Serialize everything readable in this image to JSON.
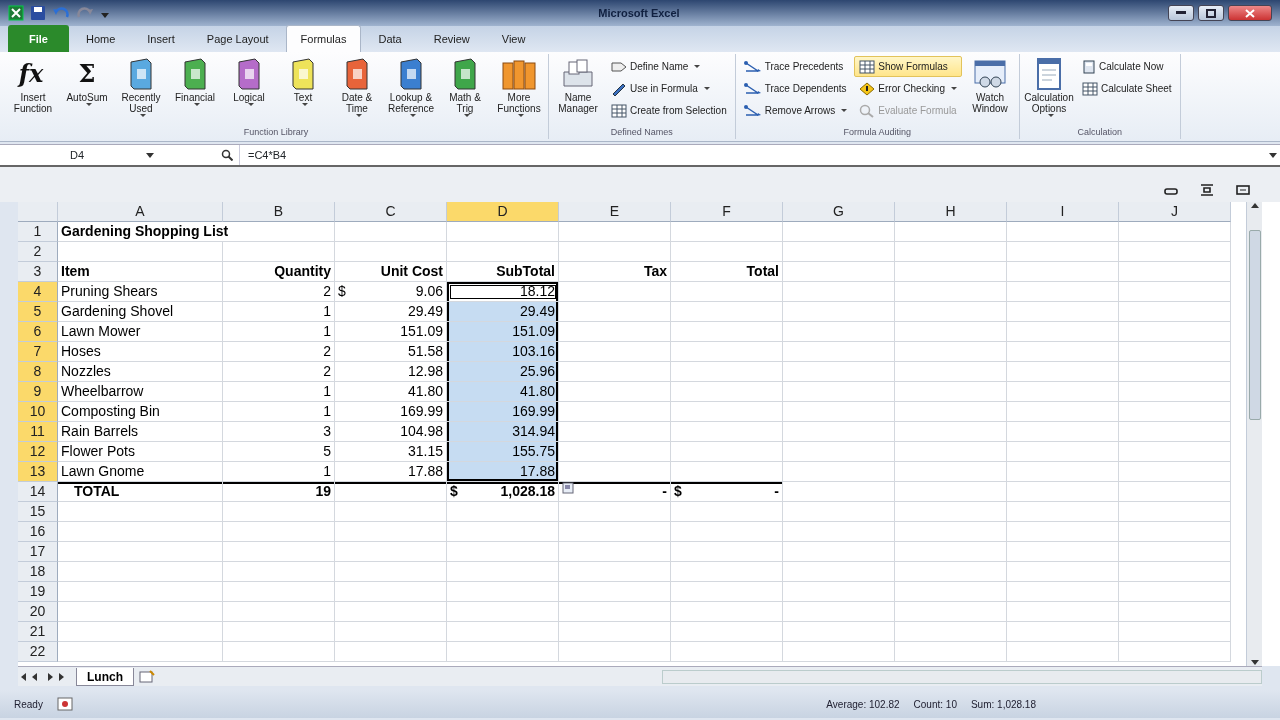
{
  "title_bar": {
    "title": "Microsoft Excel"
  },
  "tabs": [
    {
      "label": "File",
      "kind": "file",
      "selected": false
    },
    {
      "label": "Home",
      "kind": "tab",
      "selected": false
    },
    {
      "label": "Insert",
      "kind": "tab",
      "selected": false
    },
    {
      "label": "Page Layout",
      "kind": "tab",
      "selected": false
    },
    {
      "label": "Formulas",
      "kind": "tab",
      "selected": true
    },
    {
      "label": "Data",
      "kind": "tab",
      "selected": false
    },
    {
      "label": "Review",
      "kind": "tab",
      "selected": false
    },
    {
      "label": "View",
      "kind": "tab",
      "selected": false
    }
  ],
  "ribbon_groups": [
    {
      "label": "Function Library",
      "items": [
        {
          "kind": "large",
          "label": "Insert Function",
          "glyph": "fx",
          "dropdown": false
        },
        {
          "kind": "large",
          "label": "AutoSum",
          "glyph": "Σ",
          "dropdown": true
        },
        {
          "kind": "large",
          "label": "Recently Used",
          "dropdown": true
        },
        {
          "kind": "large",
          "label": "Financial",
          "dropdown": true
        },
        {
          "kind": "large",
          "label": "Logical",
          "dropdown": true
        },
        {
          "kind": "large",
          "label": "Text",
          "dropdown": true
        },
        {
          "kind": "large",
          "label": "Date & Time",
          "dropdown": true
        },
        {
          "kind": "large",
          "label": "Lookup & Reference",
          "dropdown": true
        },
        {
          "kind": "large",
          "label": "Math & Trig",
          "dropdown": true
        },
        {
          "kind": "large",
          "label": "More Functions",
          "dropdown": true
        }
      ]
    },
    {
      "label": "Defined Names",
      "items": [
        {
          "kind": "large",
          "label": "Name Manager",
          "dropdown": false
        },
        {
          "kind": "stack",
          "buttons": [
            {
              "label": "Define Name",
              "dropdown": true,
              "hovered": false,
              "disabled": false
            },
            {
              "label": "Use in Formula",
              "dropdown": true,
              "hovered": false,
              "disabled": false
            },
            {
              "label": "Create from Selection",
              "dropdown": false,
              "hovered": false,
              "disabled": false
            }
          ]
        }
      ]
    },
    {
      "label": "Formula Auditing",
      "items": [
        {
          "kind": "stack",
          "buttons": [
            {
              "label": "Trace Precedents",
              "dropdown": false,
              "hovered": false,
              "disabled": false
            },
            {
              "label": "Trace Dependents",
              "dropdown": false,
              "hovered": false,
              "disabled": false
            },
            {
              "label": "Remove Arrows",
              "dropdown": true,
              "hovered": false,
              "disabled": false
            }
          ]
        },
        {
          "kind": "stack",
          "buttons": [
            {
              "label": "Show Formulas",
              "dropdown": false,
              "hovered": true,
              "disabled": false
            },
            {
              "label": "Error Checking",
              "dropdown": true,
              "hovered": false,
              "disabled": false
            },
            {
              "label": "Evaluate Formula",
              "dropdown": false,
              "hovered": false,
              "disabled": true
            }
          ]
        },
        {
          "kind": "large",
          "label": "Watch Window",
          "dropdown": false
        }
      ]
    },
    {
      "label": "Calculation",
      "items": [
        {
          "kind": "large",
          "label": "Calculation Options",
          "dropdown": true
        },
        {
          "kind": "stack",
          "buttons": [
            {
              "label": "Calculate Now",
              "dropdown": false,
              "hovered": false,
              "disabled": false
            },
            {
              "label": "Calculate Sheet",
              "dropdown": false,
              "hovered": false,
              "disabled": false
            }
          ]
        }
      ]
    }
  ],
  "formula_bar": {
    "name_box": "D4",
    "formula": "=C4*B4"
  },
  "sheet": {
    "columns": [
      {
        "label": "A",
        "selected": false
      },
      {
        "label": "B",
        "selected": false
      },
      {
        "label": "C",
        "selected": false
      },
      {
        "label": "D",
        "selected": true
      },
      {
        "label": "E",
        "selected": false
      },
      {
        "label": "F",
        "selected": false
      },
      {
        "label": "G",
        "selected": false
      },
      {
        "label": "H",
        "selected": false
      },
      {
        "label": "I",
        "selected": false
      },
      {
        "label": "J",
        "selected": false
      }
    ],
    "rows": [
      {
        "number": "1",
        "selected": false,
        "bold": true,
        "total": false,
        "cells": [
          {
            "text": "Gardening Shopping List",
            "selected": false
          }
        ]
      },
      {
        "number": "2",
        "selected": false,
        "total": false,
        "cells": []
      },
      {
        "number": "3",
        "selected": false,
        "bold": true,
        "total": false,
        "cells": [
          {
            "text": "Item",
            "selected": false
          },
          {
            "text": "Quantity",
            "selected": false
          },
          {
            "text": "Unit Cost",
            "selected": false
          },
          {
            "text": "SubTotal",
            "selected": false
          },
          {
            "text": "Tax",
            "selected": false
          },
          {
            "text": "Total",
            "selected": false
          }
        ]
      },
      {
        "number": "4",
        "selected": true,
        "bold": false,
        "total": false,
        "cells": [
          {
            "text": "Pruning Shears",
            "selected": false
          },
          {
            "text": "2",
            "selected": false
          },
          {
            "symbol": "$",
            "text": "9.06",
            "selected": false
          },
          {
            "text": "18.12",
            "selected": true,
            "active": true
          }
        ]
      },
      {
        "number": "5",
        "selected": true,
        "bold": false,
        "total": false,
        "cells": [
          {
            "text": "Gardening Shovel",
            "selected": false
          },
          {
            "text": "1",
            "selected": false
          },
          {
            "text": "29.49",
            "selected": false
          },
          {
            "text": "29.49",
            "selected": true,
            "active": false
          }
        ]
      },
      {
        "number": "6",
        "selected": true,
        "bold": false,
        "total": false,
        "cells": [
          {
            "text": "Lawn Mower",
            "selected": false
          },
          {
            "text": "1",
            "selected": false
          },
          {
            "text": "151.09",
            "selected": false
          },
          {
            "text": "151.09",
            "selected": true,
            "active": false
          }
        ]
      },
      {
        "number": "7",
        "selected": true,
        "bold": false,
        "total": false,
        "cells": [
          {
            "text": "Hoses",
            "selected": false
          },
          {
            "text": "2",
            "selected": false
          },
          {
            "text": "51.58",
            "selected": false
          },
          {
            "text": "103.16",
            "selected": true,
            "active": false
          }
        ]
      },
      {
        "number": "8",
        "selected": true,
        "bold": false,
        "total": false,
        "cells": [
          {
            "text": "Nozzles",
            "selected": false
          },
          {
            "text": "2",
            "selected": false
          },
          {
            "text": "12.98",
            "selected": false
          },
          {
            "text": "25.96",
            "selected": true,
            "active": false
          }
        ]
      },
      {
        "number": "9",
        "selected": true,
        "bold": false,
        "total": false,
        "cells": [
          {
            "text": "Wheelbarrow",
            "selected": false
          },
          {
            "text": "1",
            "selected": false
          },
          {
            "text": "41.80",
            "selected": false
          },
          {
            "text": "41.80",
            "selected": true,
            "active": false
          }
        ]
      },
      {
        "number": "10",
        "selected": true,
        "bold": false,
        "total": false,
        "cells": [
          {
            "text": "Composting Bin",
            "selected": false
          },
          {
            "text": "1",
            "selected": false
          },
          {
            "text": "169.99",
            "selected": false
          },
          {
            "text": "169.99",
            "selected": true,
            "active": false
          }
        ]
      },
      {
        "number": "11",
        "selected": true,
        "bold": false,
        "total": false,
        "cells": [
          {
            "text": "Rain Barrels",
            "selected": false
          },
          {
            "text": "3",
            "selected": false
          },
          {
            "text": "104.98",
            "selected": false
          },
          {
            "text": "314.94",
            "selected": true,
            "active": false
          }
        ]
      },
      {
        "number": "12",
        "selected": true,
        "bold": false,
        "total": false,
        "cells": [
          {
            "text": "Flower Pots",
            "selected": false
          },
          {
            "text": "5",
            "selected": false
          },
          {
            "text": "31.15",
            "selected": false
          },
          {
            "text": "155.75",
            "selected": true,
            "active": false
          }
        ]
      },
      {
        "number": "13",
        "selected": true,
        "bold": false,
        "total": false,
        "cells": [
          {
            "text": "Lawn Gnome",
            "selected": false
          },
          {
            "text": "1",
            "selected": false
          },
          {
            "text": "17.88",
            "selected": false
          },
          {
            "text": "17.88",
            "selected": true,
            "active": false
          }
        ]
      },
      {
        "number": "14",
        "selected": false,
        "bold": true,
        "total": true,
        "cells": [
          {
            "text": "TOTAL",
            "selected": false
          },
          {
            "text": "19",
            "selected": false
          },
          {
            "selected": false
          },
          {
            "symbol": "$",
            "text": "1,028.18",
            "selected": false
          },
          {
            "text": "-",
            "selected": false,
            "smart_tag": true
          },
          {
            "symbol": "$",
            "text": "-",
            "selected": false
          }
        ]
      },
      {
        "number": "15",
        "selected": false,
        "total": false,
        "cells": []
      },
      {
        "number": "16",
        "selected": false,
        "total": false,
        "cells": []
      },
      {
        "number": "17",
        "selected": false,
        "total": false,
        "cells": []
      },
      {
        "number": "18",
        "selected": false,
        "total": false,
        "cells": []
      },
      {
        "number": "19",
        "selected": false,
        "total": false,
        "cells": []
      },
      {
        "number": "20",
        "selected": false,
        "total": false,
        "cells": []
      },
      {
        "number": "21",
        "selected": false,
        "total": false,
        "cells": []
      },
      {
        "number": "22",
        "selected": false,
        "total": false,
        "cells": []
      }
    ]
  },
  "sheet_tabs": [
    {
      "label": "Lunch",
      "selected": true
    }
  ],
  "status_bar": {
    "mode": "Ready",
    "stats": [
      "Average: 102.82",
      "Count: 10",
      "Sum: 1,028.18"
    ]
  }
}
